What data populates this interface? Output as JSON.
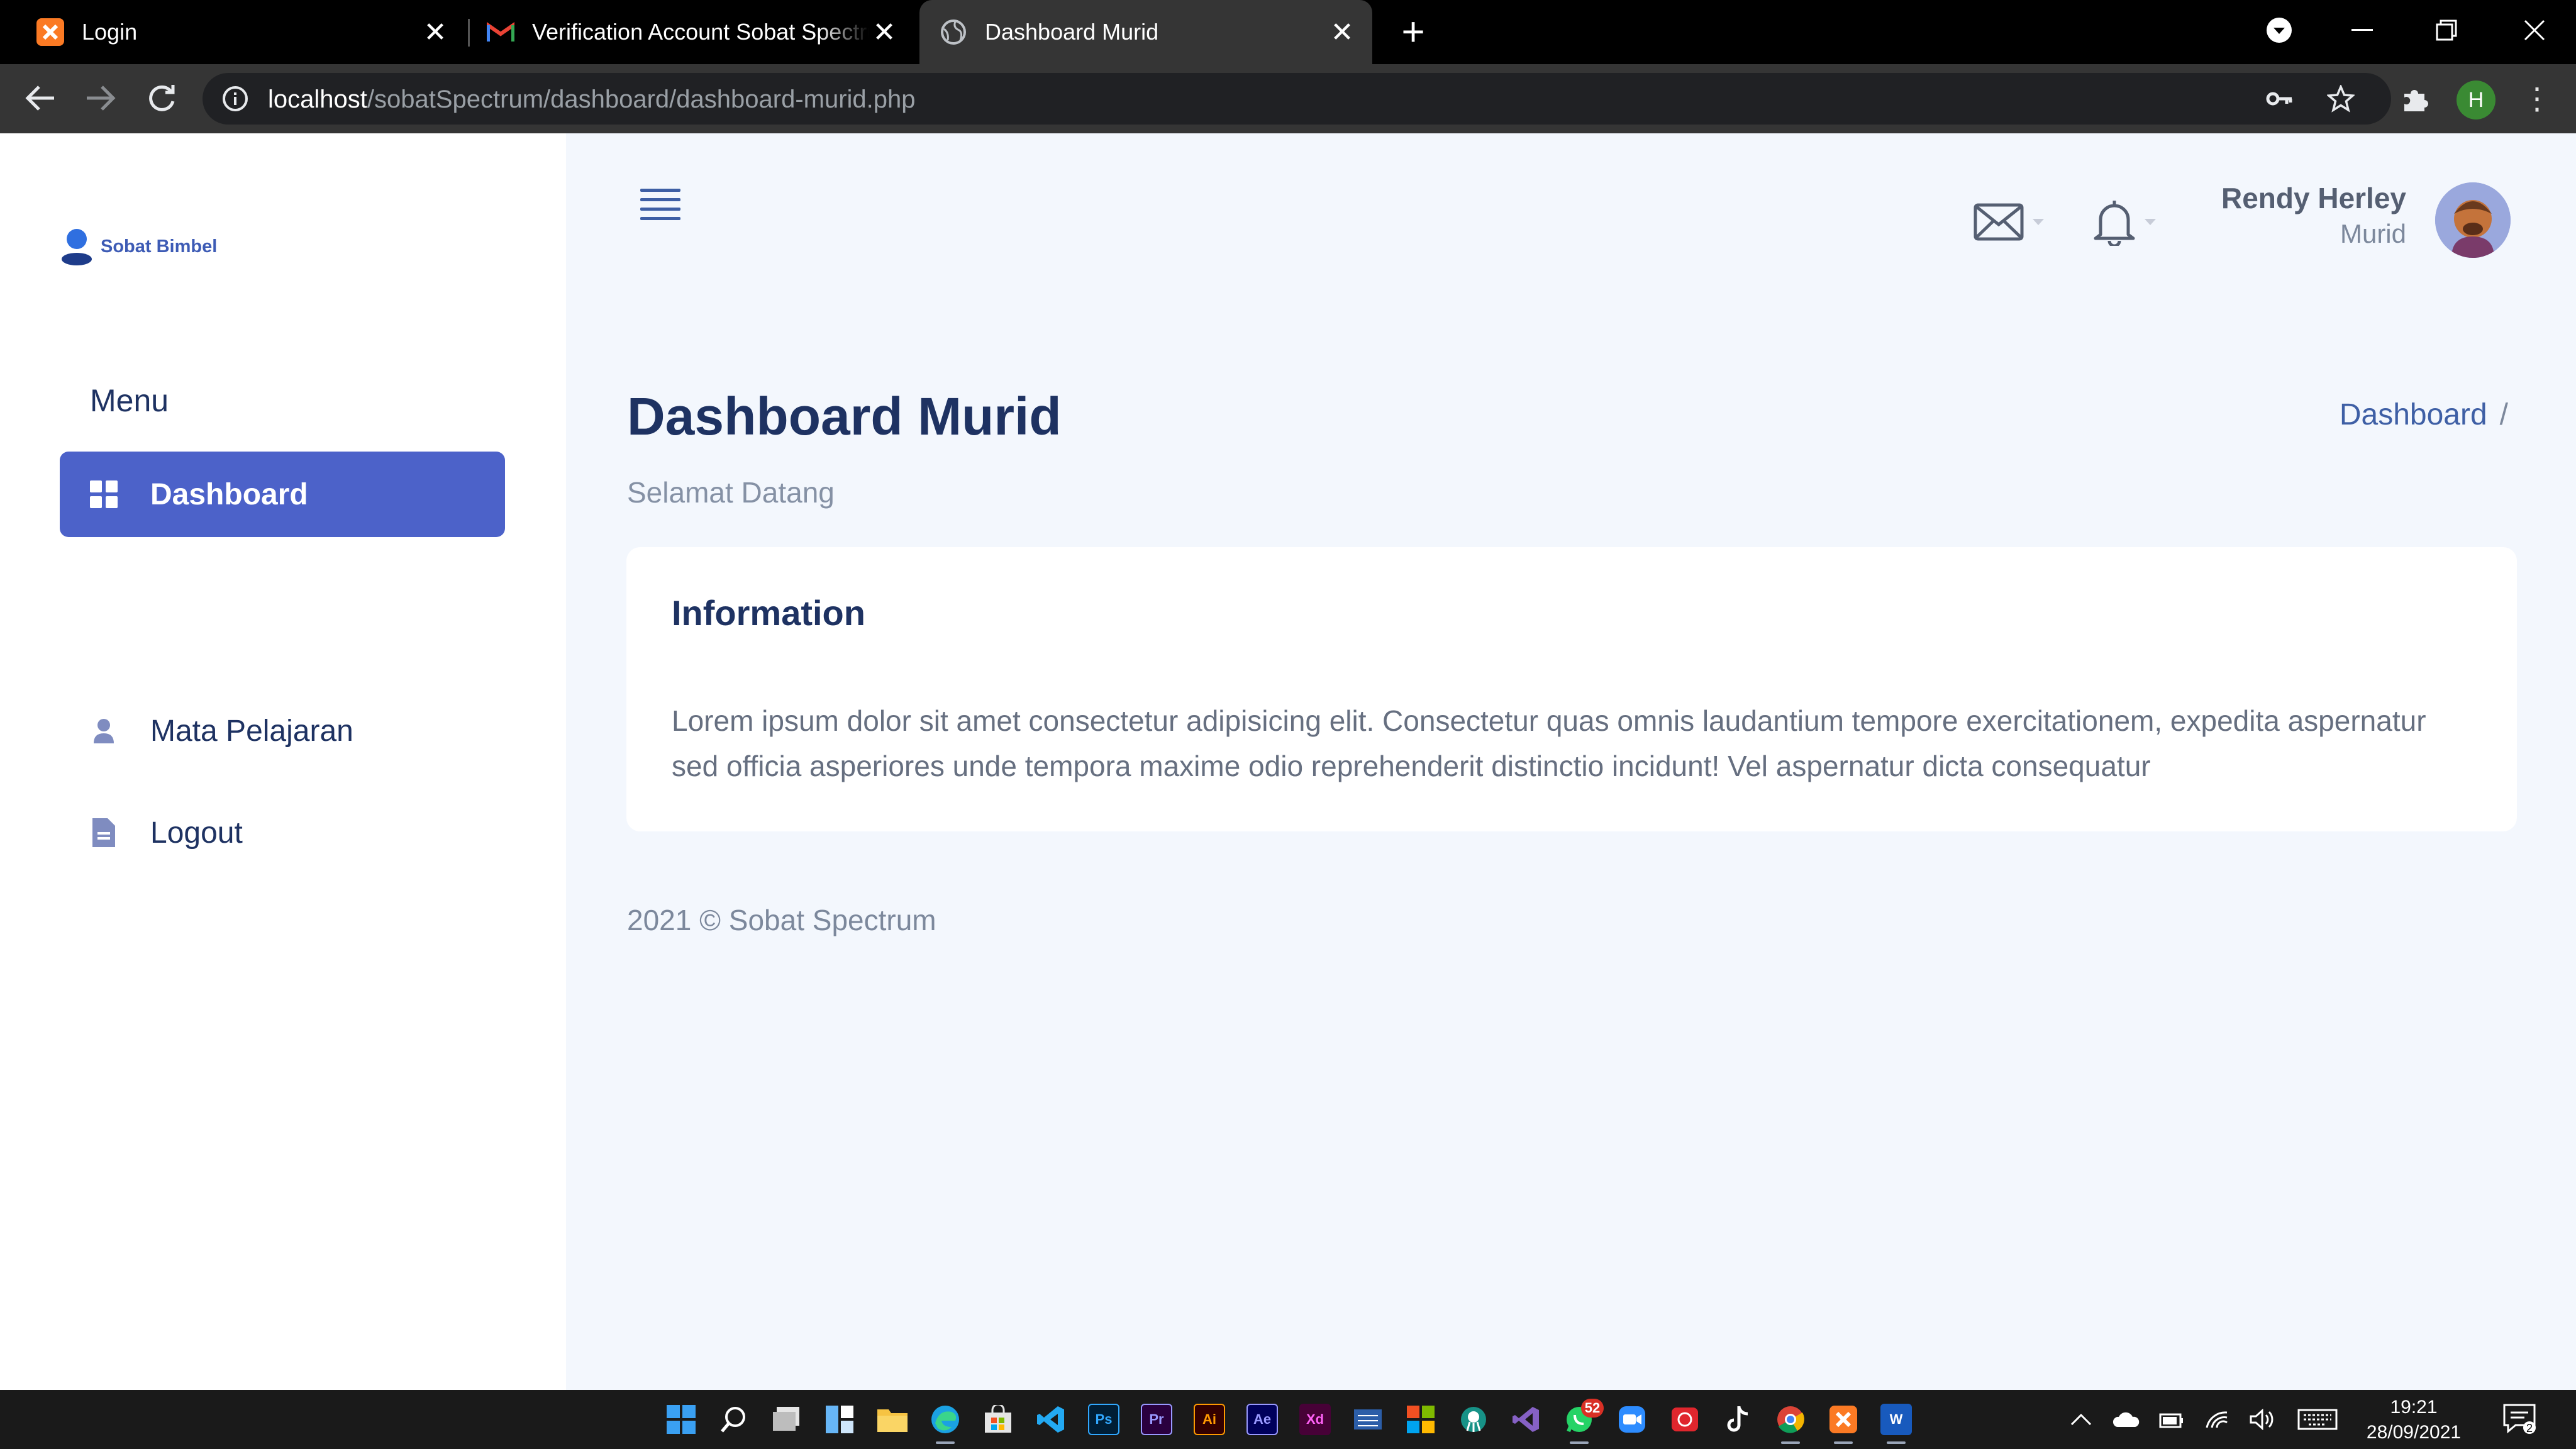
{
  "browser": {
    "tabs": [
      {
        "title": "Login",
        "favicon": "xampp-icon"
      },
      {
        "title": "Verification Account Sobat Spectrum",
        "favicon": "gmail-icon"
      },
      {
        "title": "Dashboard Murid",
        "favicon": "globe-icon",
        "active": true
      }
    ],
    "url": {
      "host": "localhost",
      "path": "/sobatSpectrum/dashboard/dashboard-murid.php"
    },
    "profile_initial": "H"
  },
  "sidebar": {
    "brand": "Sobat Bimbel",
    "menu_heading": "Menu",
    "items": [
      {
        "label": "Dashboard",
        "icon": "grid-icon",
        "active": true
      },
      {
        "label": "Mata Pelajaran",
        "icon": "user-icon",
        "active": false
      },
      {
        "label": "Logout",
        "icon": "document-icon",
        "active": false
      }
    ]
  },
  "header": {
    "user_name": "Rendy Herley",
    "user_role": "Murid",
    "icons": [
      "menu-icon",
      "mail-icon",
      "bell-icon"
    ]
  },
  "main": {
    "title": "Dashboard Murid",
    "subtitle": "Selamat Datang",
    "breadcrumb": "Dashboard",
    "breadcrumb_sep": "/",
    "card": {
      "title": "Information",
      "body": "Lorem ipsum dolor sit amet consectetur adipisicing elit. Consectetur quas omnis laudantium tempore exercitationem, expedita aspernatur sed officia asperiores unde tempora maxime odio reprehenderit distinctio incidunt! Vel aspernatur dicta consequatur"
    },
    "footer": "2021 © Sobat Spectrum"
  },
  "taskbar": {
    "whatsapp_badge": "52",
    "time": "19:21",
    "date": "28/09/2021",
    "notification_count": "2",
    "app_labels": {
      "photoshop": "Ps",
      "premiere": "Pr",
      "illustrator": "Ai",
      "after_effects": "Ae",
      "xd": "Xd",
      "word": "W"
    }
  },
  "colors": {
    "accent": "#4c62c9",
    "heading": "#1e3262",
    "content_bg": "#f3f7fd"
  }
}
